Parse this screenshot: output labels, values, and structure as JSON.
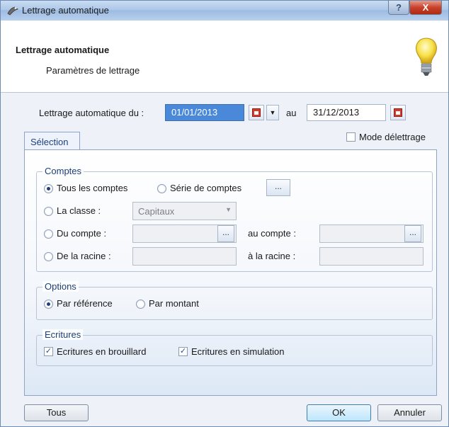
{
  "window": {
    "title": "Lettrage automatique",
    "help_label": "?",
    "close_label": "X"
  },
  "header": {
    "title": "Lettrage automatique",
    "subtitle": "Paramètres de lettrage",
    "icon": "lightbulb-icon"
  },
  "date_range": {
    "from_label": "Lettrage automatique du :",
    "from_value": "01/01/2013",
    "to_label": "au",
    "to_value": "31/12/2013"
  },
  "tab": {
    "label": "Sélection"
  },
  "mode_delettrage": {
    "label": "Mode délettrage",
    "checked": false
  },
  "comptes": {
    "title": "Comptes",
    "tous_les_comptes": {
      "label": "Tous les comptes",
      "selected": true
    },
    "serie_de_comptes": {
      "label": "Série de comptes",
      "selected": false,
      "button": "..."
    },
    "la_classe": {
      "label": "La classe :",
      "value": "Capitaux"
    },
    "du_compte": {
      "label": "Du compte :",
      "button": "..."
    },
    "au_compte": {
      "label": "au compte :",
      "button": "..."
    },
    "de_la_racine": {
      "label": "De la racine :"
    },
    "a_la_racine": {
      "label": "à la racine :"
    }
  },
  "options": {
    "title": "Options",
    "par_reference": {
      "label": "Par référence",
      "selected": true
    },
    "par_montant": {
      "label": "Par montant",
      "selected": false
    }
  },
  "ecritures": {
    "title": "Ecritures",
    "brouillard": {
      "label": "Ecritures en brouillard",
      "checked": true
    },
    "simulation": {
      "label": "Ecritures en simulation",
      "checked": true
    }
  },
  "footer": {
    "tous": "Tous",
    "ok": "OK",
    "annuler": "Annuler"
  },
  "colors": {
    "accent": "#4a89d9",
    "group_title": "#1e3e73"
  }
}
